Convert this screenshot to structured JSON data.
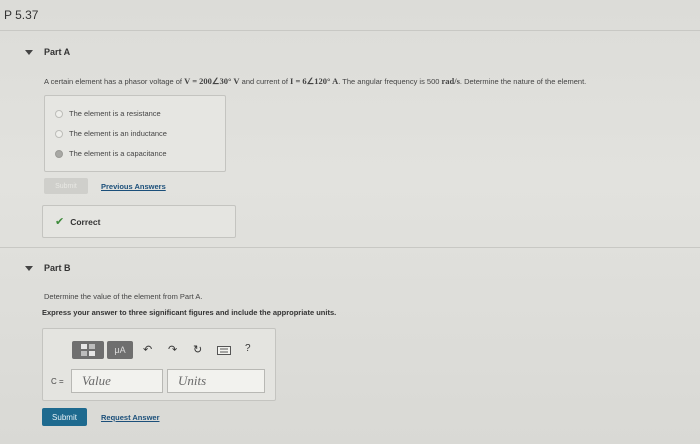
{
  "problem": {
    "title": "P 5.37"
  },
  "partA": {
    "label": "Part A",
    "prompt": {
      "t1": "A certain element has a phasor voltage of ",
      "v": "V = 200∠30° V",
      "t2": " and current of ",
      "i": "I = 6∠120° A",
      "t3": ". The angular frequency is 500 ",
      "unit": "rad/s",
      "t4": ". Determine the nature of the element."
    },
    "choices": [
      {
        "label": "The element is a resistance",
        "selected": false
      },
      {
        "label": "The element is an inductance",
        "selected": false
      },
      {
        "label": "The element is a capacitance",
        "selected": true
      }
    ],
    "submit_label": "Submit",
    "previous_answers_label": "Previous Answers",
    "status": "Correct"
  },
  "partB": {
    "label": "Part B",
    "prompt": "Determine the value of the element from Part A.",
    "instruction": "Express your answer to three significant figures and include the appropriate units.",
    "toolbar": {
      "mu_label": "μA",
      "help_label": "?"
    },
    "variable_label": "C =",
    "value_placeholder": "Value",
    "units_placeholder": "Units",
    "submit_label": "Submit",
    "request_answer_label": "Request Answer"
  },
  "colors": {
    "accent": "#1e6a8f",
    "correct": "#3d8a3a"
  },
  "icons": [
    "caret-down-icon",
    "templates-icon",
    "mu-units-icon",
    "undo-icon",
    "redo-icon",
    "reset-icon",
    "keyboard-icon",
    "help-icon",
    "checkmark-icon"
  ]
}
